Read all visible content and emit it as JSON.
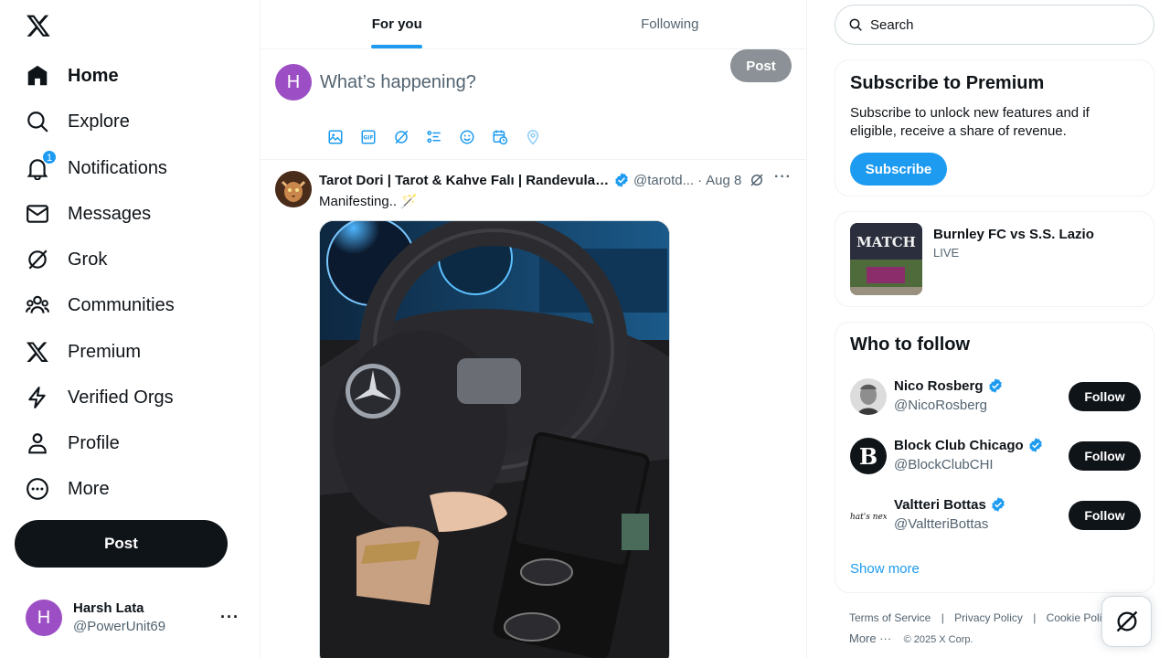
{
  "nav": {
    "items": [
      {
        "label": "Home",
        "icon": "home-icon"
      },
      {
        "label": "Explore",
        "icon": "search-icon"
      },
      {
        "label": "Notifications",
        "icon": "bell-icon",
        "badge": "1"
      },
      {
        "label": "Messages",
        "icon": "mail-icon"
      },
      {
        "label": "Grok",
        "icon": "grok-icon"
      },
      {
        "label": "Communities",
        "icon": "people-icon"
      },
      {
        "label": "Premium",
        "icon": "x-logo-icon"
      },
      {
        "label": "Verified Orgs",
        "icon": "lightning-icon"
      },
      {
        "label": "Profile",
        "icon": "person-icon"
      },
      {
        "label": "More",
        "icon": "more-circle-icon"
      }
    ],
    "post_label": "Post"
  },
  "account": {
    "initial": "H",
    "name": "Harsh Lata",
    "handle": "@PowerUnit69",
    "more": "···"
  },
  "timeline": {
    "tabs": [
      {
        "label": "For you"
      },
      {
        "label": "Following"
      }
    ],
    "composer": {
      "initial": "H",
      "placeholder": "What’s happening?",
      "post_label": "Post"
    },
    "tweet": {
      "author": "Tarot Dori | Tarot & Kahve Falı | Randevular ...",
      "handle": "@tarotd...",
      "sep": "·",
      "date": "Aug 8",
      "text": "Manifesting.. 🪄",
      "more": "···"
    }
  },
  "sidebar": {
    "search_placeholder": "Search",
    "premium": {
      "title": "Subscribe to Premium",
      "body": "Subscribe to unlock new features and if eligible, receive a share of revenue.",
      "button": "Subscribe"
    },
    "live": {
      "title": "Burnley FC vs S.S. Lazio",
      "status": "LIVE",
      "thumb_text": "MATCH"
    },
    "who_to_follow": {
      "title": "Who to follow",
      "people": [
        {
          "name": "Nico Rosberg",
          "handle": "@NicoRosberg",
          "follow": "Follow"
        },
        {
          "name": "Block Club Chicago",
          "handle": "@BlockClubCHI",
          "follow": "Follow",
          "avatar_letter": "B"
        },
        {
          "name": "Valtteri Bottas",
          "handle": "@ValtteriBottas",
          "follow": "Follow",
          "avatar_text": "What's next?"
        }
      ],
      "show_more": "Show more"
    },
    "footer": {
      "links": [
        "Terms of Service",
        "Privacy Policy",
        "Cookie Policy"
      ],
      "divider": "|",
      "more": "More ···",
      "copyright": "© 2025 X Corp."
    }
  },
  "colors": {
    "accent": "#1d9bf0",
    "text": "#0f1419",
    "muted": "#536471",
    "avatar": "#9c4fc4"
  }
}
